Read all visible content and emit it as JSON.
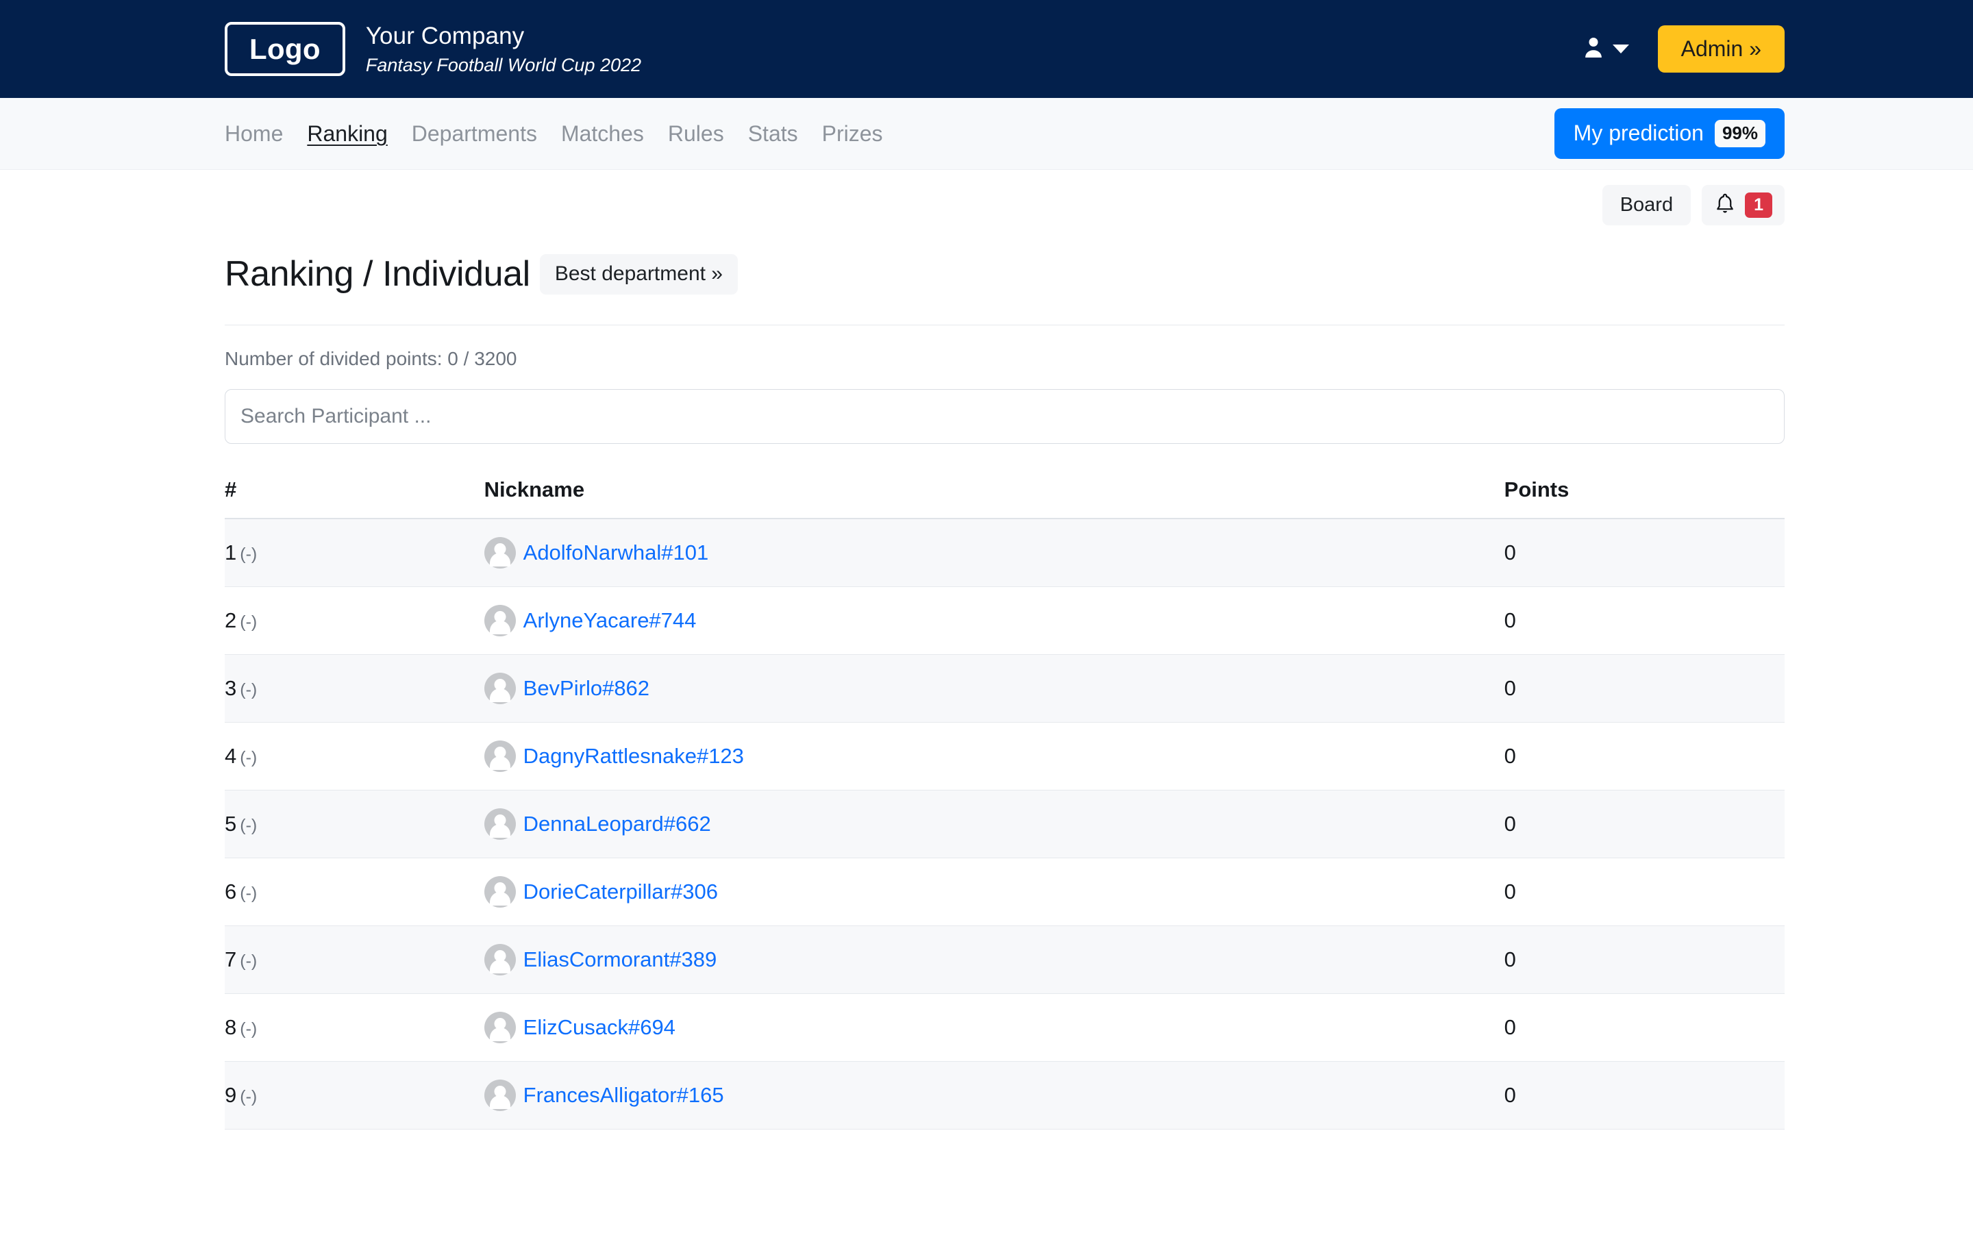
{
  "header": {
    "logo_label": "Logo",
    "company": "Your Company",
    "tagline": "Fantasy Football World Cup 2022",
    "user_icon": "user-icon",
    "caret_icon": "chevron-down-icon",
    "admin_label": "Admin »"
  },
  "nav": {
    "items": [
      {
        "label": "Home",
        "active": false
      },
      {
        "label": "Ranking",
        "active": true
      },
      {
        "label": "Departments",
        "active": false
      },
      {
        "label": "Matches",
        "active": false
      },
      {
        "label": "Rules",
        "active": false
      },
      {
        "label": "Stats",
        "active": false
      },
      {
        "label": "Prizes",
        "active": false
      }
    ],
    "prediction_label": "My prediction",
    "prediction_badge": "99%"
  },
  "subbar": {
    "board_label": "Board",
    "bell_icon": "bell-icon",
    "bell_count": "1"
  },
  "main": {
    "title": "Ranking / Individual",
    "best_department_label": "Best department »",
    "points_note": "Number of divided points: 0 / 3200",
    "search_placeholder": "Search Participant ...",
    "search_value": ""
  },
  "table": {
    "columns": [
      "#",
      "Nickname",
      "Points"
    ],
    "rows": [
      {
        "rank": "1",
        "delta": "(-)",
        "nickname": "AdolfoNarwhal#101",
        "points": "0"
      },
      {
        "rank": "2",
        "delta": "(-)",
        "nickname": "ArlyneYacare#744",
        "points": "0"
      },
      {
        "rank": "3",
        "delta": "(-)",
        "nickname": "BevPirlo#862",
        "points": "0"
      },
      {
        "rank": "4",
        "delta": "(-)",
        "nickname": "DagnyRattlesnake#123",
        "points": "0"
      },
      {
        "rank": "5",
        "delta": "(-)",
        "nickname": "DennaLeopard#662",
        "points": "0"
      },
      {
        "rank": "6",
        "delta": "(-)",
        "nickname": "DorieCaterpillar#306",
        "points": "0"
      },
      {
        "rank": "7",
        "delta": "(-)",
        "nickname": "EliasCormorant#389",
        "points": "0"
      },
      {
        "rank": "8",
        "delta": "(-)",
        "nickname": "ElizCusack#694",
        "points": "0"
      },
      {
        "rank": "9",
        "delta": "(-)",
        "nickname": "FrancesAlligator#165",
        "points": "0"
      }
    ]
  },
  "colors": {
    "header_bg": "#03204c",
    "nav_bg": "#f7f9fb",
    "admin_accent": "#ffc21c",
    "primary_blue": "#007bff",
    "link_blue": "#0d6efd",
    "danger_red": "#dc3545",
    "row_stripe": "#f7f8fa"
  }
}
